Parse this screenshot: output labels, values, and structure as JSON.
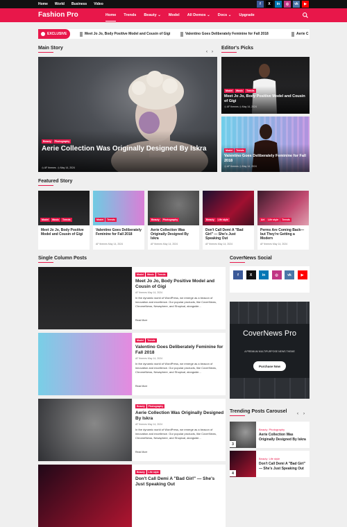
{
  "topbar": {
    "links": [
      "Home",
      "World",
      "Business",
      "Video"
    ],
    "social": [
      {
        "icon": "facebook-icon",
        "glyph": "f",
        "color": "#3b5998"
      },
      {
        "icon": "x-icon",
        "glyph": "X",
        "color": "#000000"
      },
      {
        "icon": "linkedin-icon",
        "glyph": "in",
        "color": "#0077b5"
      },
      {
        "icon": "instagram-icon",
        "glyph": "◎",
        "color": "#c13584"
      },
      {
        "icon": "vk-icon",
        "glyph": "vk",
        "color": "#4a76a8"
      },
      {
        "icon": "youtube-icon",
        "glyph": "▶",
        "color": "#ff0000"
      }
    ]
  },
  "nav": {
    "brand": "Fashion Pro",
    "items": [
      "Home",
      "Trends",
      "Beauty ⌄",
      "Model",
      "All Demos ⌄",
      "Docs ⌄",
      "Upgrade"
    ]
  },
  "ticker": {
    "label": "EXCLUSIVE",
    "items": [
      "Meet Jo Jo, Body Positive Model and Cousin of Gigi",
      "Valentino Goes Deliberately Feminine for Fall 2018",
      "Aerie C"
    ]
  },
  "main_story": {
    "heading": "Main Story",
    "cats": [
      "Beauty",
      "Photography"
    ],
    "title": "Aerie Collection Was Originally Designed By Iskra",
    "author": "AF themes",
    "date": "May 14, 2024"
  },
  "editors_picks": {
    "heading": "Editor's Picks",
    "items": [
      {
        "cats": [
          "Model",
          "Music",
          "Trends"
        ],
        "title": "Meet Jo Jo, Body Positive Model and Cousin of Gigi",
        "author": "AF themes",
        "date": "May 14, 2024"
      },
      {
        "cats": [
          "Model",
          "Trends"
        ],
        "title": "Valentino Goes Deliberately Feminine for Fall 2018",
        "author": "AF themes",
        "date": "May 14, 2024"
      }
    ]
  },
  "featured": {
    "heading": "Featured Story",
    "items": [
      {
        "cats": [
          "Model",
          "Music",
          "Trends"
        ],
        "title": "Meet Jo Jo, Body Positive Model and Cousin of Gigi",
        "author": "",
        "date": ""
      },
      {
        "cats": [
          "Model",
          "Trends"
        ],
        "title": "Valentino Goes Deliberately Feminine for Fall 2018",
        "author": "AF themes",
        "date": "May 14, 2024"
      },
      {
        "cats": [
          "Beauty",
          "Photography"
        ],
        "title": "Aerie Collection Was Originally Designed By Iskra",
        "author": "AF themes",
        "date": "May 14, 2024"
      },
      {
        "cats": [
          "Beauty",
          "Life style"
        ],
        "title": "Don't Call Demi A \"Bad Girl\" — She's Just Speaking Out",
        "author": "AF themes",
        "date": "May 14, 2024"
      },
      {
        "cats": [
          "Art",
          "Life style",
          "Trends"
        ],
        "title": "Perms Are Coming Back— but They're Getting a Modern",
        "author": "AF themes",
        "date": "May 14, 2024"
      }
    ]
  },
  "single_column": {
    "heading": "Single Column Posts",
    "excerpt": "In the dynamic world of WordPress, we emerge as a beacon of innovation and excellence. Our popular products, like CoverNews, ChromeNews, Newsphere, and Shopical, alongside...",
    "read_more": "Read More",
    "posts": [
      {
        "cats": [
          "Model",
          "Music",
          "Trends"
        ],
        "title": "Meet Jo Jo, Body Positive Model and Cousin of Gigi",
        "author": "AF themes",
        "date": "May 14, 2024"
      },
      {
        "cats": [
          "Model",
          "Trends"
        ],
        "title": "Valentino Goes Deliberately Feminine for Fall 2018",
        "author": "AF themes",
        "date": "May 14, 2024"
      },
      {
        "cats": [
          "Beauty",
          "Photography"
        ],
        "title": "Aerie Collection Was Originally Designed By Iskra",
        "author": "AF themes",
        "date": "May 14, 2024"
      },
      {
        "cats": [
          "Beauty",
          "Life style"
        ],
        "title": "Don't Call Demi A \"Bad Girl\" — She's Just Speaking Out",
        "author": "",
        "date": ""
      }
    ]
  },
  "social_widget": {
    "heading": "CoverNews Social",
    "row1": [
      {
        "icon": "facebook-icon",
        "glyph": "f",
        "color": "#3b5998"
      },
      {
        "icon": "x-icon",
        "glyph": "X",
        "color": "#111111"
      },
      {
        "icon": "linkedin-icon",
        "glyph": "in",
        "color": "#0077b5"
      },
      {
        "icon": "instagram-icon",
        "glyph": "◎",
        "color": "#c13584"
      },
      {
        "icon": "vk-icon",
        "glyph": "vk",
        "color": "#4a76a8"
      },
      {
        "icon": "youtube-icon",
        "glyph": "▶",
        "color": "#ff0000"
      }
    ]
  },
  "promo": {
    "title": "CoverNews Pro",
    "subtitle": "A PREMIUM MULTIPURPOSE NEWS THEME",
    "button": "Purchase Now"
  },
  "carousel": {
    "heading": "Trending Posts Carousel",
    "items": [
      {
        "num": "3",
        "cats": [
          "Beauty",
          "Photography"
        ],
        "title": "Aerie Collection Was Originally Designed By Iskra"
      },
      {
        "num": "4",
        "cats": [
          "Beauty",
          "Life style"
        ],
        "title": "Don't Call Demi A \"Bad Girl\" — She's Just Speaking Out"
      }
    ]
  },
  "colors": {
    "accent": "#e8174a",
    "dark": "#111111"
  }
}
